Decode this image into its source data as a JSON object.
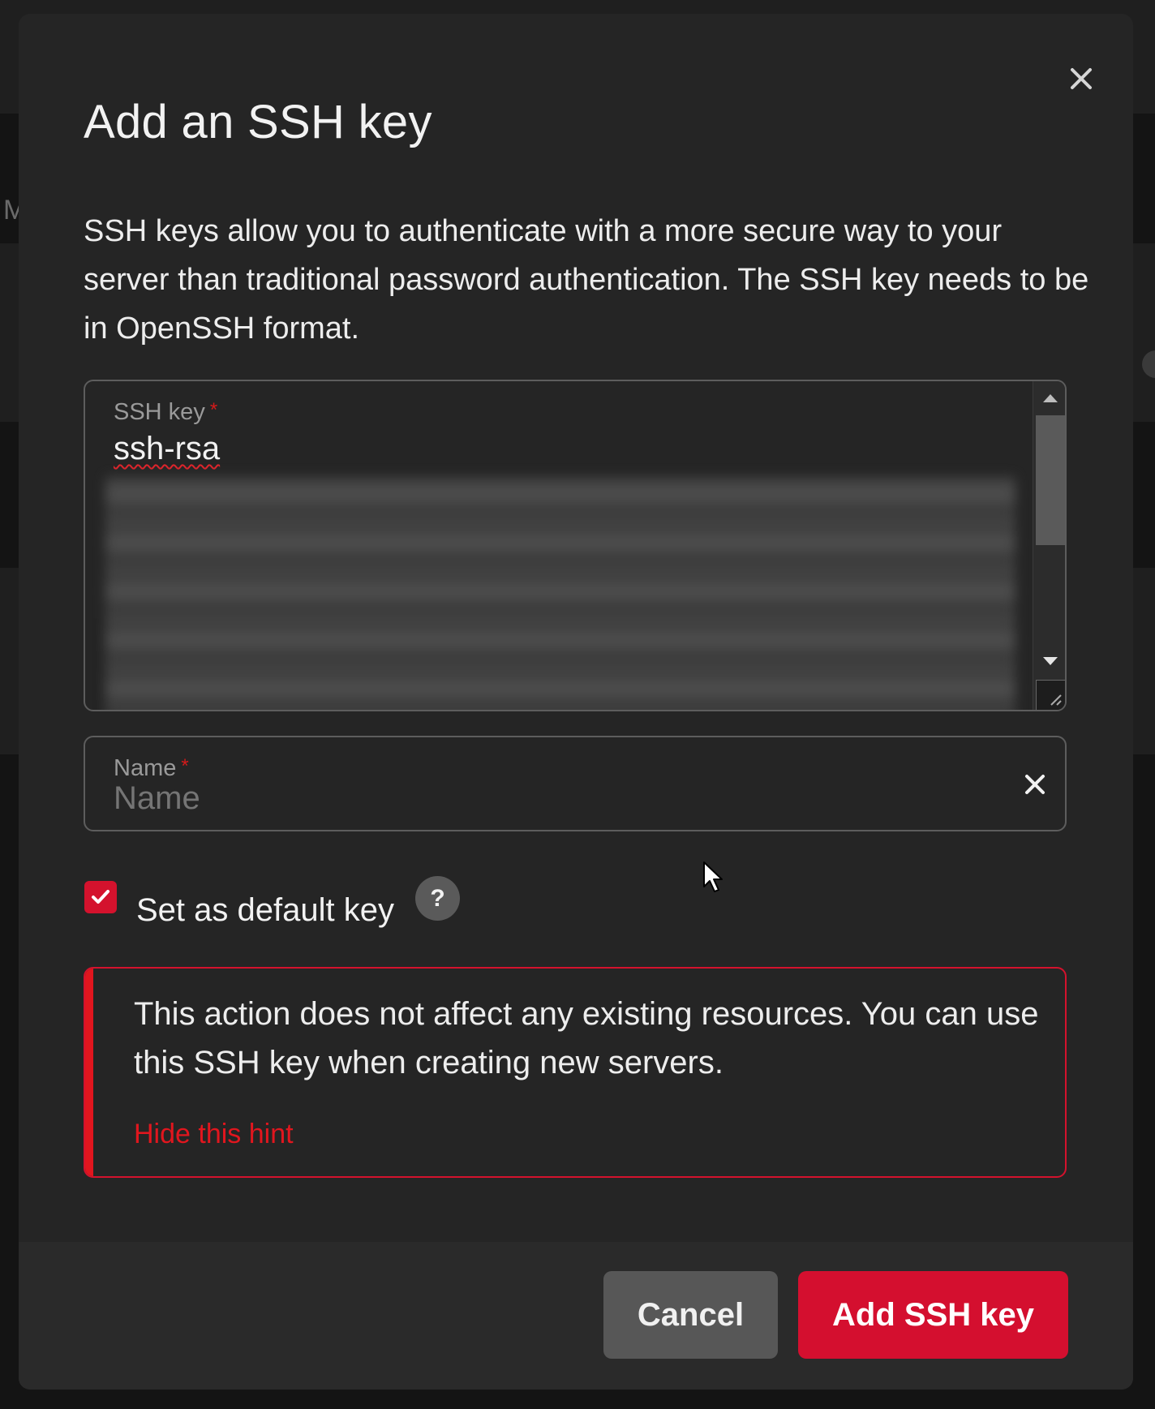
{
  "background": {
    "partial_letter": "M"
  },
  "dialog": {
    "title": "Add an SSH key",
    "description": "SSH keys allow you to authenticate with a more secure way to your server than traditional password authentication. The SSH key needs to be in OpenSSH format.",
    "close_icon": "close-icon"
  },
  "ssh_key_field": {
    "label": "SSH key",
    "required_marker": "*",
    "value": "ssh-rsa",
    "redacted": true
  },
  "name_field": {
    "label": "Name",
    "required_marker": "*",
    "placeholder": "Name",
    "clear_icon": "clear-icon"
  },
  "default_key": {
    "label": "Set as default key",
    "checked": true,
    "help_symbol": "?"
  },
  "hint": {
    "text": "This action does not affect any existing resources. You can use this SSH key when creating new servers.",
    "hide_link": "Hide this hint"
  },
  "footer": {
    "cancel_label": "Cancel",
    "submit_label": "Add SSH key"
  },
  "colors": {
    "accent": "#d40f2f",
    "modal_bg": "#252525",
    "backdrop": "#141414"
  }
}
